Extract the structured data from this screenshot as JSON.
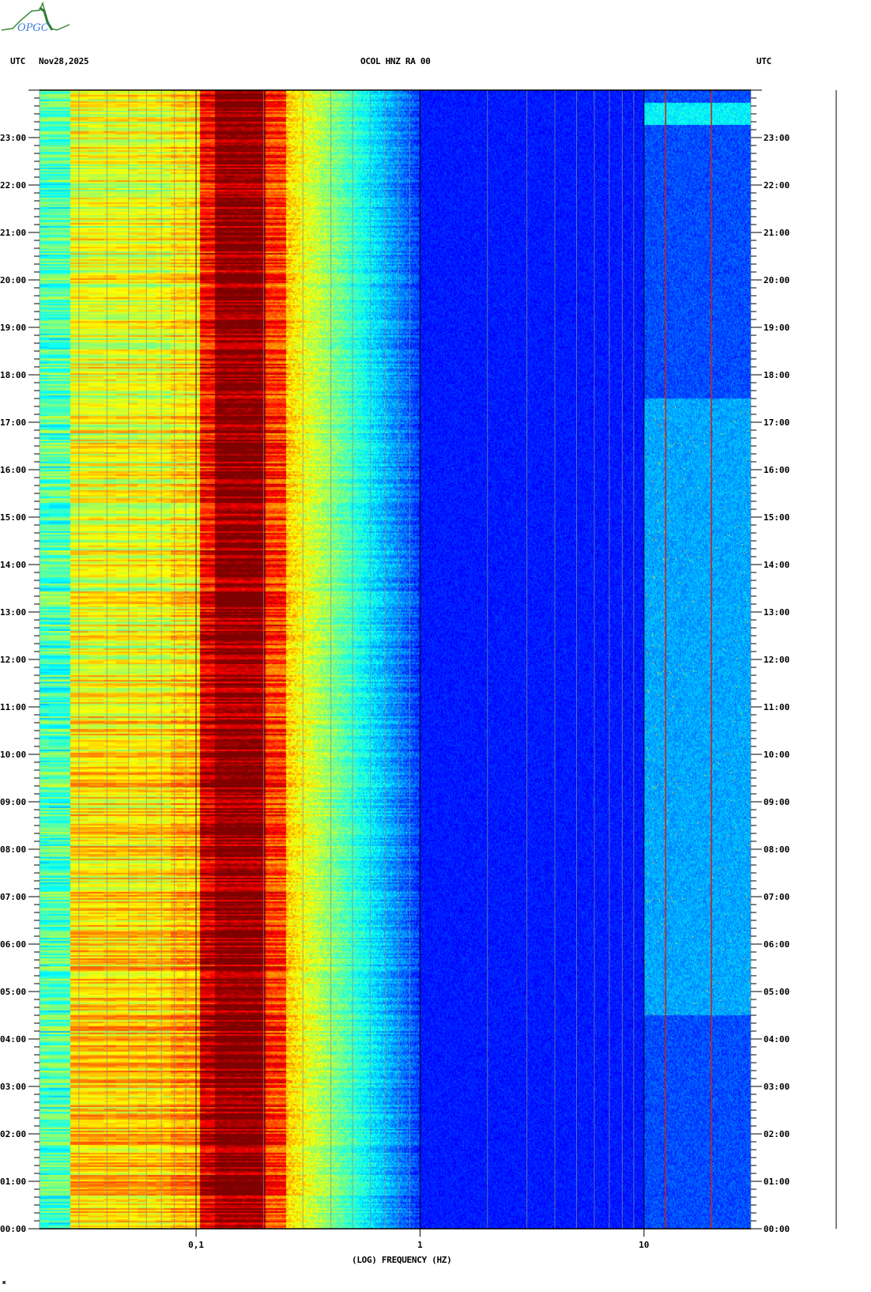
{
  "logo": {
    "text": "OPGC"
  },
  "header": {
    "left_tz": "UTC",
    "date": "Nov28,2025",
    "title": "OCOL HNZ RA 00",
    "right_tz": "UTC"
  },
  "chart_data": {
    "type": "heatmap",
    "title": "OCOL HNZ RA 00",
    "date": "Nov28,2025",
    "xlabel": "(LOG) FREQUENCY (HZ)",
    "xscale": "log",
    "xlim": [
      0.02,
      30
    ],
    "x_ticks": [
      {
        "value": 0.1,
        "label": "0,1"
      },
      {
        "value": 1,
        "label": "1"
      },
      {
        "value": 10,
        "label": "10"
      }
    ],
    "ylabel_left": "UTC",
    "ylabel_right": "UTC",
    "ylim": [
      "00:00",
      "24:00"
    ],
    "y_ticks": [
      "00:00",
      "01:00",
      "02:00",
      "03:00",
      "04:00",
      "05:00",
      "06:00",
      "07:00",
      "08:00",
      "09:00",
      "10:00",
      "11:00",
      "12:00",
      "13:00",
      "14:00",
      "15:00",
      "16:00",
      "17:00",
      "18:00",
      "19:00",
      "20:00",
      "21:00",
      "22:00",
      "23:00"
    ],
    "y_minor_tick_minutes": 10,
    "colormap": "jet",
    "grid": true,
    "marker_lines_hz": [
      12.5,
      20
    ],
    "marker_line_color": "#d02010",
    "energy_profile": [
      {
        "band": "0.02-0.025 Hz",
        "level": "cyan-green"
      },
      {
        "band": "0.025-0.1 Hz",
        "level": "yellow-orange, higher 00:00-12:00"
      },
      {
        "band": "0.1-0.2 Hz",
        "level": "dark red (max)"
      },
      {
        "band": "0.2-0.25 Hz",
        "level": "orange-yellow"
      },
      {
        "band": "0.25-1 Hz",
        "level": "decaying cyan to blue"
      },
      {
        "band": "1-10 Hz",
        "level": "blue (low)"
      },
      {
        "band": "10-30 Hz",
        "level": "blue with bursts 05:00-17:00 and 23:15-23:45"
      }
    ]
  }
}
